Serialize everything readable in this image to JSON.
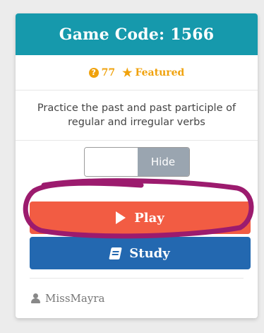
{
  "header": {
    "title": "Game Code: 1566"
  },
  "meta": {
    "count": "77",
    "featured_label": "Featured"
  },
  "description": "Practice the past and past participle of regular and irregular verbs",
  "toggle": {
    "label": "Hide"
  },
  "buttons": {
    "play": "Play",
    "study": "Study"
  },
  "author": {
    "name": "MissMayra"
  },
  "colors": {
    "header": "#1699ac",
    "meta": "#f0a20c",
    "play": "#f25c43",
    "study": "#2368b0",
    "annotation": "#9c1b6e"
  },
  "icons": {
    "question": "question-circle-icon",
    "star": "star-icon",
    "play": "play-icon",
    "book": "book-icon",
    "user": "user-icon"
  }
}
